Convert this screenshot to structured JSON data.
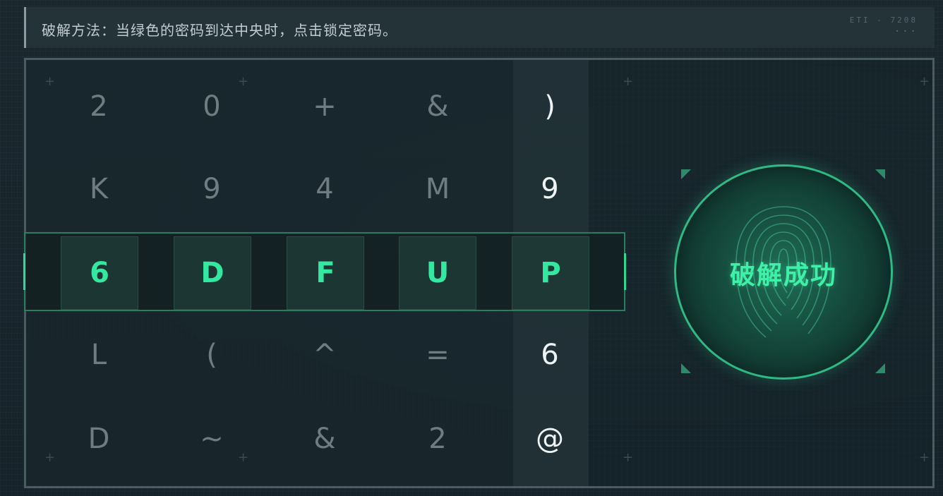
{
  "instruction": {
    "text": "破解方法：当绿色的密码到达中央时，点击锁定密码。",
    "corner_code": "ETI - 7208",
    "corner_dots": "• • •"
  },
  "grid": {
    "rows": [
      [
        "2",
        "0",
        "+",
        "&",
        ")"
      ],
      [
        "K",
        "9",
        "4",
        "M",
        "9"
      ],
      [
        "L",
        "(",
        "^",
        "=",
        "6"
      ],
      [
        "D",
        "~",
        "&",
        "2",
        "@"
      ]
    ]
  },
  "locked_code": [
    "6",
    "D",
    "F",
    "U",
    "P"
  ],
  "fingerprint_button": {
    "label": "破解成功"
  },
  "colors": {
    "accent_green": "#33e8a0",
    "dim_text": "#6f7d82",
    "bright_text": "#eef3f4"
  }
}
